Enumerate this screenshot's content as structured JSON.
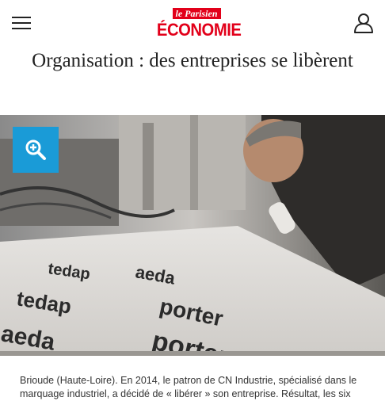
{
  "header": {
    "menu_icon": "hamburger-menu-icon",
    "logo_top": "le Parisien",
    "logo_main": "ÉCONOMIE",
    "account_icon": "user-account-icon",
    "brand_color": "#e2001a"
  },
  "article": {
    "title": "Organisation : des entreprises se libèrent",
    "zoom_icon": "zoom-in-icon",
    "zoom_button_color": "#1a9bd7",
    "plate_text": [
      "porter",
      "tedap",
      "aeda"
    ],
    "caption": "Brioude (Haute-Loire). En 2014, le patron de CN Industrie, spécialisé dans le marquage industriel, a décidé de « libérer » son entreprise. Résultat, les six"
  }
}
